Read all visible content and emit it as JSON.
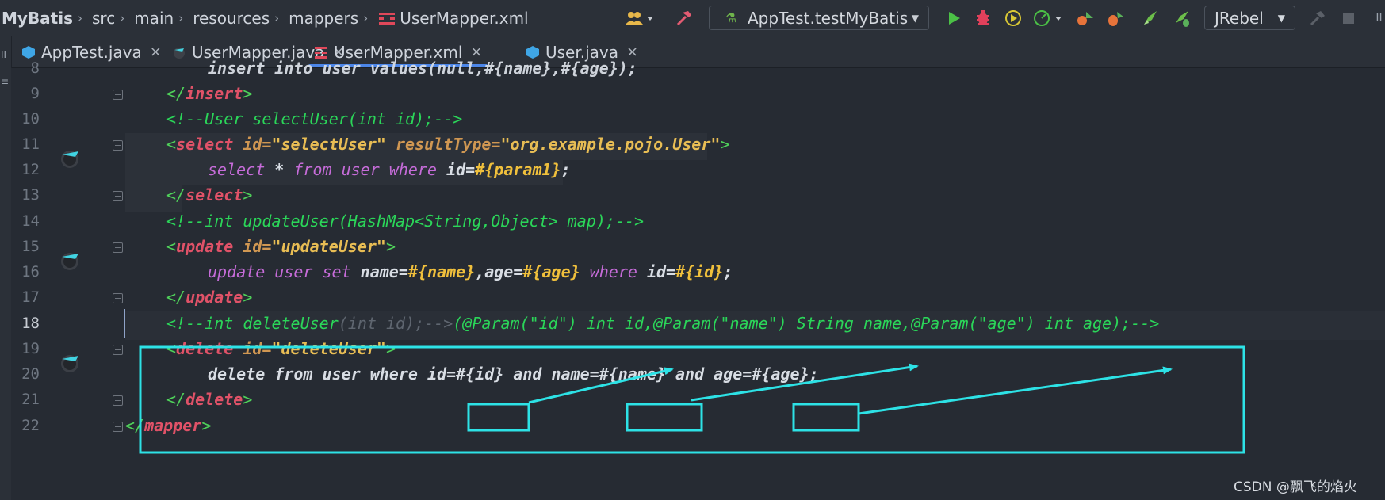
{
  "breadcrumb": [
    "MyBatis",
    "src",
    "main",
    "resources",
    "mappers",
    "UserMapper.xml"
  ],
  "toolbar": {
    "run_config": "AppTest.testMyBatis",
    "jrebel": "JRebel"
  },
  "tabs": [
    {
      "label": "AppTest.java",
      "icon": "java-class-icon"
    },
    {
      "label": "UserMapper.java",
      "icon": "mybatis-interface-icon"
    },
    {
      "label": "UserMapper.xml",
      "icon": "xml-icon",
      "active": true
    },
    {
      "label": "User.java",
      "icon": "java-class-icon"
    }
  ],
  "side_strip": [
    "II",
    "≡"
  ],
  "editor": {
    "line_numbers": [
      "8",
      "9",
      "10",
      "11",
      "12",
      "13",
      "14",
      "15",
      "16",
      "17",
      "18",
      "19",
      "20",
      "21",
      "22"
    ],
    "current_line": "18",
    "lines": {
      "l8": {
        "p1": "insert into user values(null,#{name},#{age});"
      },
      "l9": {
        "p1": "</",
        "p2": "insert",
        "p3": ">"
      },
      "l10": {
        "p1": "<!--User selectUser(int id);-->"
      },
      "l11": {
        "p1": "<",
        "p2": "select",
        "p3": " id=",
        "p4": "\"selectUser\"",
        "p5": " resultType=",
        "p6": "\"org.example.pojo.User\"",
        "p7": ">"
      },
      "l12": {
        "p1": "select",
        "p2": " * ",
        "p3": "from",
        "p4": " ",
        "p5": "user",
        "p6": " ",
        "p7": "where",
        "p8": " id=",
        "p9": "#{param1}",
        "p10": ";"
      },
      "l13": {
        "p1": "</",
        "p2": "select",
        "p3": ">"
      },
      "l14": {
        "p1": "<!--int updateUser(HashMap<String,Object> map);-->"
      },
      "l15": {
        "p1": "<",
        "p2": "update",
        "p3": " id=",
        "p4": "\"updateUser\"",
        "p5": ">"
      },
      "l16": {
        "p1": "update",
        "p2": " ",
        "p3": "user",
        "p4": " ",
        "p5": "set",
        "p6": " name=",
        "p7": "#{name}",
        "p8": ",age=",
        "p9": "#{age}",
        "p10": " ",
        "p11": "where",
        "p12": " id=",
        "p13": "#{id}",
        "p14": ";"
      },
      "l17": {
        "p1": "</",
        "p2": "update",
        "p3": ">"
      },
      "l18": {
        "p1": "<!--int deleteUser",
        "p2": "(int id);-->",
        "p3": "(@Param(\"id\") int id,@Param(\"name\") String name,@Param(\"age\") int age);-->"
      },
      "l19": {
        "p1": "<",
        "p2": "delete",
        "p3": " id=",
        "p4": "\"deleteUser\"",
        "p5": ">"
      },
      "l20": {
        "p1": "delete from user where id=#{id} and name=#{name} and age=#{age};"
      },
      "l21": {
        "p1": "</",
        "p2": "delete",
        "p3": ">"
      },
      "l22": {
        "p1": "</",
        "p2": "mapper",
        "p3": ">"
      }
    }
  },
  "watermark": "CSDN @飘飞的焰火",
  "colors": {
    "annotation": "#2de2e6",
    "active_tab": "#4c86e8",
    "run": "#4bc046"
  }
}
